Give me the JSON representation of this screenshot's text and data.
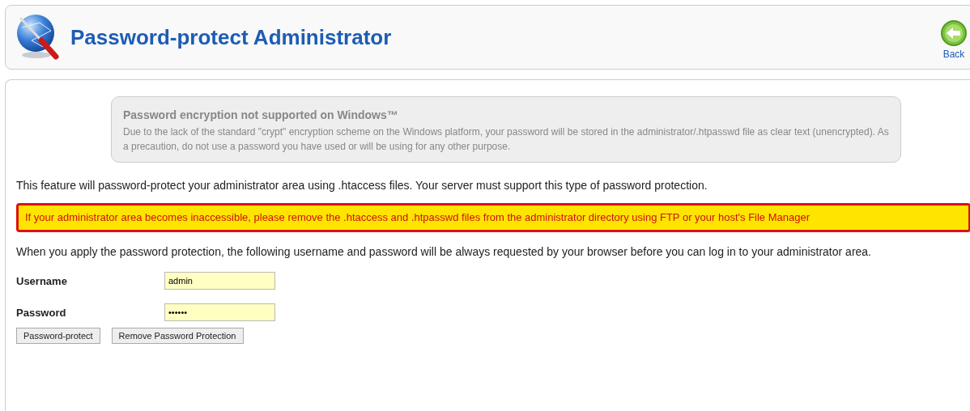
{
  "header": {
    "title": "Password-protect Administrator",
    "back_button": "Back"
  },
  "notice": {
    "title": "Password encryption not supported on Windows™",
    "text": "Due to the lack of the standard \"crypt\" encryption scheme on the Windows platform, your password will be stored in the administrator/.htpasswd file as clear text (unencrypted). As a precaution, do not use a password you have used or will be using for any other purpose."
  },
  "intro": "This feature will password-protect your administrator area using .htaccess files. Your server must support this type of password protection.",
  "warning": "If your administrator area becomes inaccessible, please remove the .htaccess and .htpasswd files from the administrator directory using FTP or your host's File Manager",
  "explanation": "When you apply the password protection, the following username and password will be always requested by your browser before you can log in to your administrator area.",
  "fields": [
    {
      "label": "Username",
      "value": "admin"
    },
    {
      "label": "Password",
      "value": "••••••"
    }
  ],
  "buttons": [
    "Password-protect",
    "Remove Password Protection"
  ]
}
